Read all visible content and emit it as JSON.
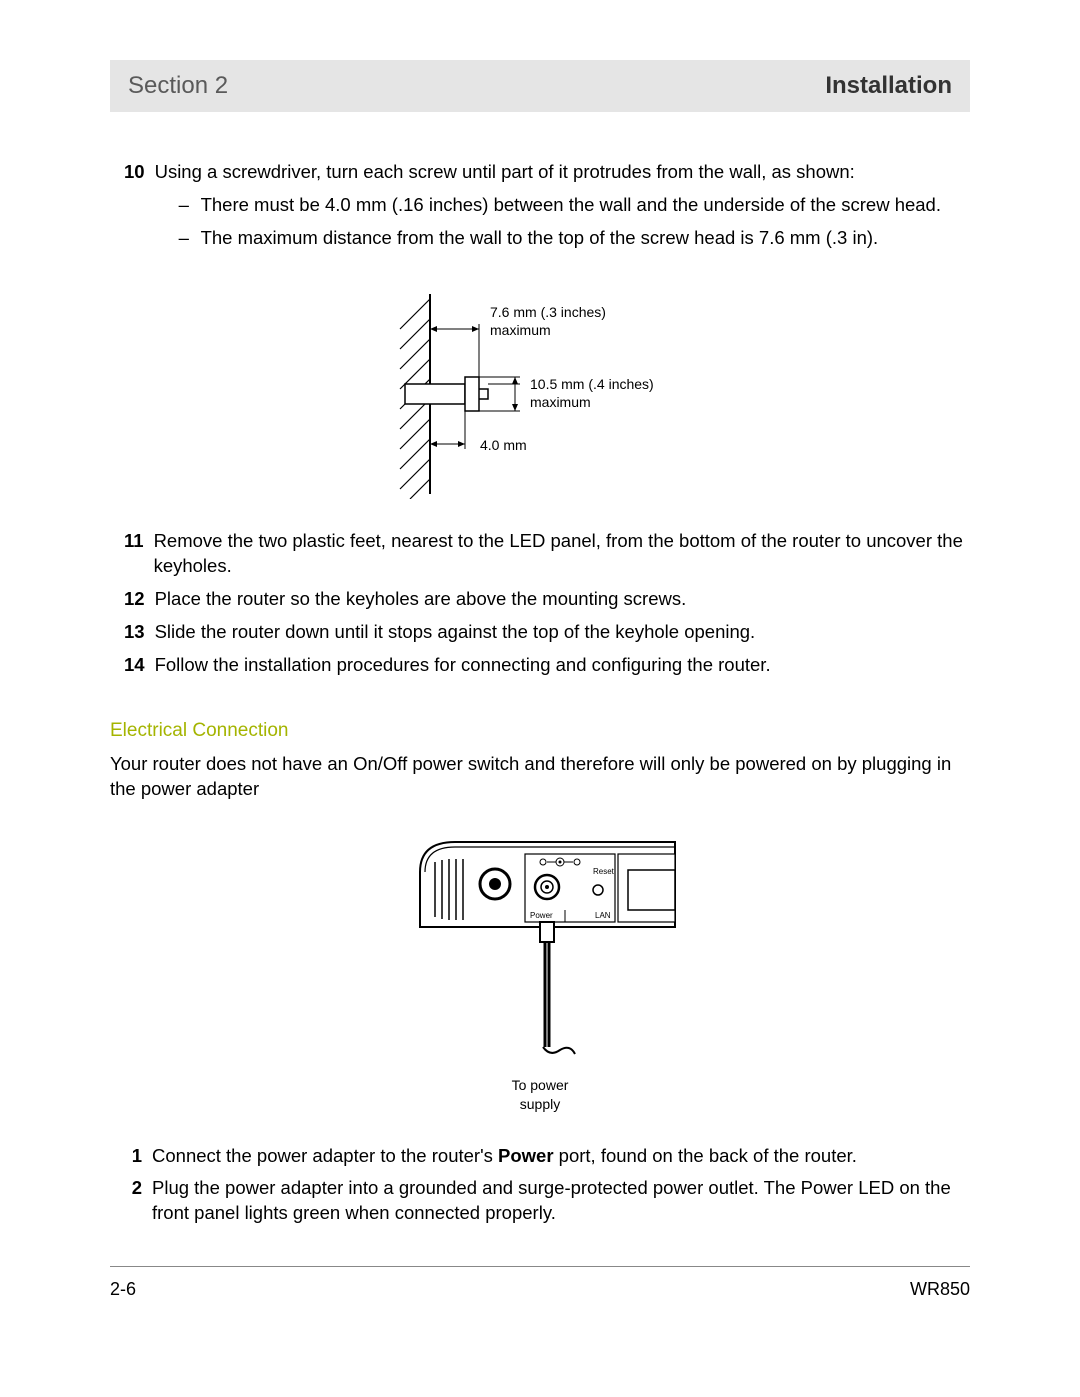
{
  "header": {
    "section_label": "Section 2",
    "title": "Installation"
  },
  "steps_a": [
    {
      "num": "10",
      "text": "Using a screwdriver, turn each screw until part of it protrudes from the wall, as shown:",
      "sub": [
        "There must be 4.0 mm (.16 inches) between the wall and the underside of the screw head.",
        "The maximum distance from the wall to the top of the screw head is 7.6 mm (.3 in)."
      ]
    }
  ],
  "fig1": {
    "label_top": "7.6 mm (.3 inches) maximum",
    "label_mid": "10.5 mm (.4 inches) maximum",
    "label_bot": "4.0 mm"
  },
  "steps_b": [
    {
      "num": "11",
      "text": "Remove the two plastic feet, nearest to the LED panel, from the bottom of the router to uncover the keyholes."
    },
    {
      "num": "12",
      "text": "Place the router so the keyholes are above the mounting screws."
    },
    {
      "num": "13",
      "text": "Slide the router down until it stops against the top of the keyhole opening."
    },
    {
      "num": "14",
      "text": "Follow the installation procedures for connecting and configuring the router."
    }
  ],
  "section2": {
    "title": "Electrical Connection",
    "para": "Your router does not have an On/Off power switch and therefore will only be powered on by plugging in the power adapter"
  },
  "fig2": {
    "reset": "Reset",
    "power": "Power",
    "lan": "LAN",
    "caption1": "To power",
    "caption2": "supply"
  },
  "steps_c": [
    {
      "num": "1",
      "pre": "Connect the power adapter to the router's ",
      "bold": "Power",
      "post": " port, found on the back of the router."
    },
    {
      "num": "2",
      "pre": "Plug the power adapter into a grounded and surge-protected power outlet. The Power LED on the front panel lights green when connected properly.",
      "bold": "",
      "post": ""
    }
  ],
  "footer": {
    "left": "2-6",
    "right": "WR850"
  }
}
